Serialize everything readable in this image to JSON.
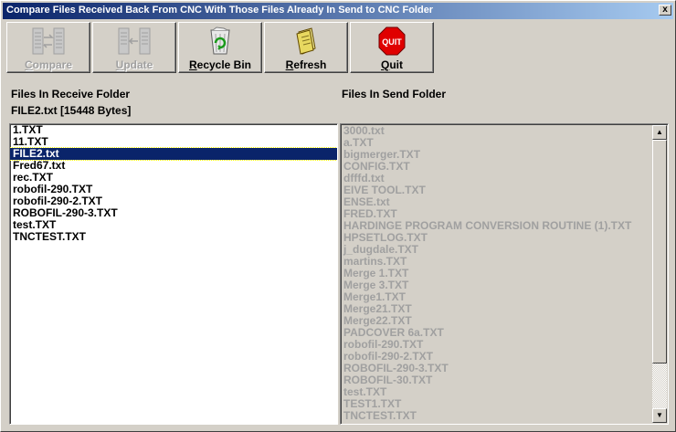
{
  "window": {
    "title": "Compare Files Received Back From CNC With Those Files Already In Send to CNC Folder",
    "close_glyph": "x"
  },
  "toolbar": {
    "buttons": [
      {
        "label_first": "C",
        "label_rest": "ompare",
        "icon": "compare-icon",
        "enabled": false
      },
      {
        "label_first": "U",
        "label_rest": "pdate",
        "icon": "update-icon",
        "enabled": false
      },
      {
        "label_first": "R",
        "label_rest": "ecycle Bin",
        "icon": "recycle-bin-icon",
        "enabled": true
      },
      {
        "label_first": "R",
        "label_rest": "efresh",
        "icon": "folder-refresh-icon",
        "enabled": true
      },
      {
        "label_first": "Q",
        "label_rest": "uit",
        "icon": "quit-stop-sign-icon",
        "enabled": true,
        "icon_text": "QUIT"
      }
    ]
  },
  "receive": {
    "heading": "Files In Receive Folder",
    "selected_info": "FILE2.txt [15448 Bytes]",
    "files": [
      "1.TXT",
      "11.TXT",
      "FILE2.txt",
      "Fred67.txt",
      "rec.TXT",
      "robofil-290.TXT",
      "robofil-290-2.TXT",
      "ROBOFIL-290-3.TXT",
      "test.TXT",
      "TNCTEST.TXT"
    ],
    "selected_index": 2
  },
  "send": {
    "heading": "Files In Send Folder",
    "files": [
      "3000.txt",
      "a.TXT",
      "bigmerger.TXT",
      "CONFIG.TXT",
      "dfffd.txt",
      "EIVE TOOL.TXT",
      "ENSE.txt",
      "FRED.TXT",
      "HARDINGE PROGRAM CONVERSION ROUTINE (1).TXT",
      "HPSETLOG.TXT",
      "j_dugdale.TXT",
      "martins.TXT",
      "Merge 1.TXT",
      "Merge 3.TXT",
      "Merge1.TXT",
      "Merge21.TXT",
      "Merge22.TXT",
      "PADCOVER 6a.TXT",
      "robofil-290.TXT",
      "robofil-290-2.TXT",
      "ROBOFIL-290-3.TXT",
      "ROBOFIL-30.TXT",
      "test.TXT",
      "TEST1.TXT",
      "TNCTEST.TXT"
    ],
    "scroll_up_glyph": "▲",
    "scroll_down_glyph": "▼"
  }
}
